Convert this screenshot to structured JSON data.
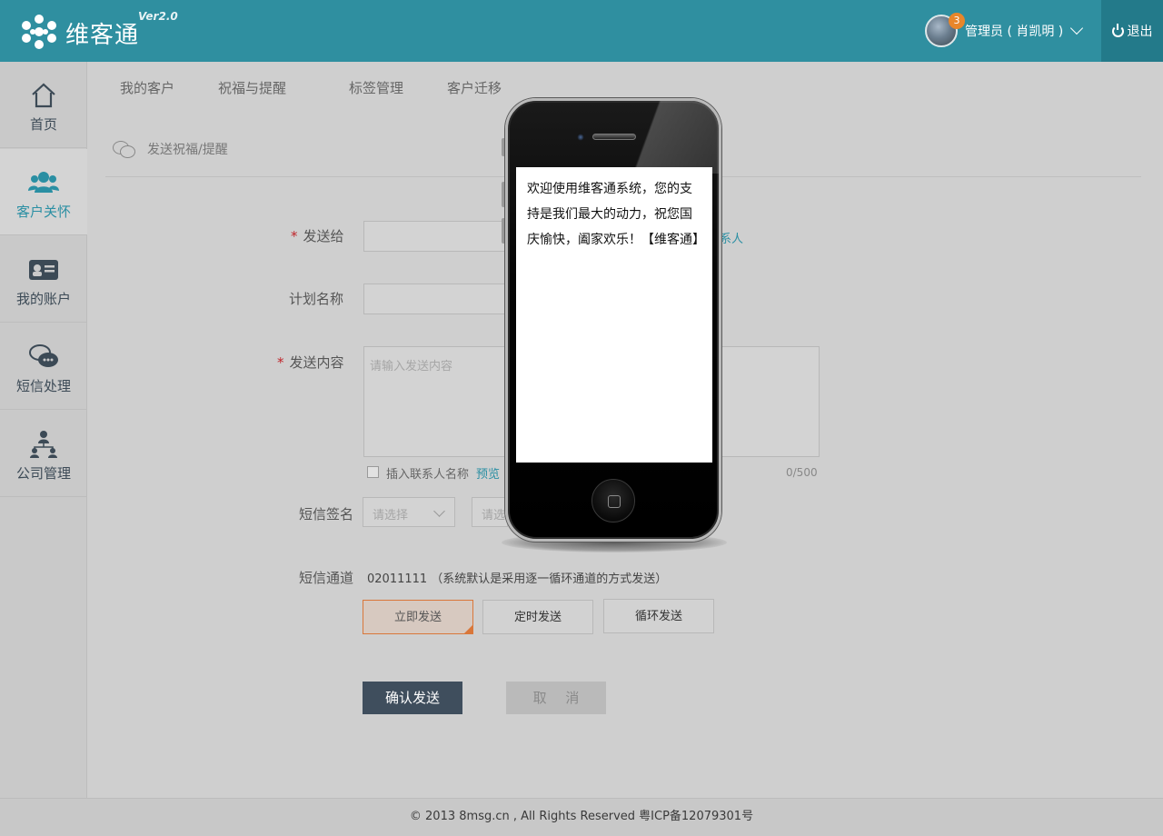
{
  "header": {
    "brand": "维客通",
    "version": "Ver2.0",
    "badge_count": "3",
    "user_name": "管理员 ( 肖凯明 )",
    "logout_label": "退出",
    "accent": "#2f8fa0"
  },
  "sidebar": {
    "items": [
      {
        "label": "首页",
        "icon": "home-icon"
      },
      {
        "label": "客户关怀",
        "icon": "users-icon"
      },
      {
        "label": "我的账户",
        "icon": "id-card-icon"
      },
      {
        "label": "短信处理",
        "icon": "chat-icon"
      },
      {
        "label": "公司管理",
        "icon": "org-icon"
      }
    ],
    "active_index": 1
  },
  "tabs": [
    "我的客户",
    "祝福与提醒",
    "标签管理",
    "客户迁移"
  ],
  "section": {
    "title": "发送祝福/提醒"
  },
  "form": {
    "send_to_label": "发送给",
    "send_to_link": "系人",
    "plan_name_label": "计划名称",
    "content_label": "发送内容",
    "content_placeholder": "请输入发送内容",
    "insert_contact_label": "插入联系人名称",
    "preview_link": "预览",
    "char_count": "0/500",
    "signature_label": "短信签名",
    "signature_placeholder": "请选择",
    "signature_placeholder_2": "请选",
    "channel_label": "短信通道",
    "channel_value": "02011111 （系统默认是采用逐一循环通道的方式发送）",
    "send_modes": [
      "立即发送",
      "定时发送",
      "循环发送"
    ],
    "selected_mode_index": 0,
    "confirm_label": "确认发送",
    "cancel_label": "取 消"
  },
  "phone_preview": {
    "message": "欢迎使用维客通系统，您的支持是我们最大的动力，祝您国庆愉快，阖家欢乐！【维客通】"
  },
  "footer": {
    "text": "© 2013 8msg.cn , All Rights Reserved 粤ICP备12079301号"
  }
}
